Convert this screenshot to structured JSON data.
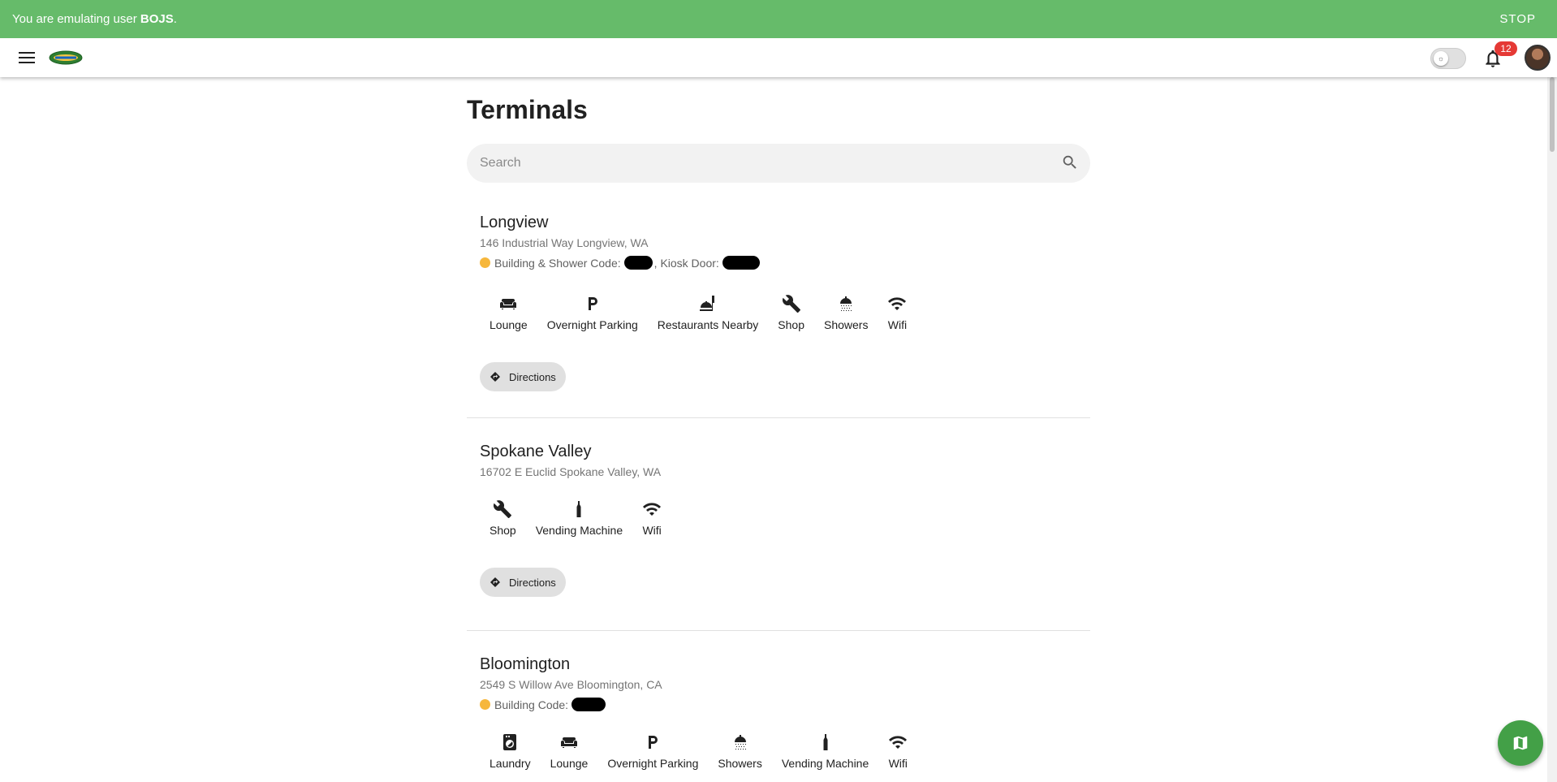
{
  "banner": {
    "prefix": "You are emulating user ",
    "user": "BOJS",
    "suffix": ".",
    "stop_label": "STOP"
  },
  "appbar": {
    "notification_count": "12",
    "theme_toggle_icon": "sun-icon"
  },
  "page": {
    "title": "Terminals",
    "search_placeholder": "Search"
  },
  "terminals": [
    {
      "name": "Longview",
      "address": "146 Industrial Way Longview, WA",
      "code_label_1": "Building & Shower Code:",
      "code_sep": ",",
      "code_label_2": "Kiosk Door:",
      "amenities": [
        "Lounge",
        "Overnight Parking",
        "Restaurants Nearby",
        "Shop",
        "Showers",
        "Wifi"
      ],
      "directions_label": "Directions"
    },
    {
      "name": "Spokane Valley",
      "address": "16702 E Euclid Spokane Valley, WA",
      "amenities": [
        "Shop",
        "Vending Machine",
        "Wifi"
      ],
      "directions_label": "Directions"
    },
    {
      "name": "Bloomington",
      "address": "2549 S Willow Ave Bloomington, CA",
      "code_label_1": "Building Code:",
      "amenities": [
        "Laundry",
        "Lounge",
        "Overnight Parking",
        "Showers",
        "Vending Machine",
        "Wifi"
      ]
    }
  ],
  "colors": {
    "banner": "#66bb6a",
    "fab": "#43a047",
    "badge": "#e53935",
    "code_dot": "#f6b73c"
  }
}
